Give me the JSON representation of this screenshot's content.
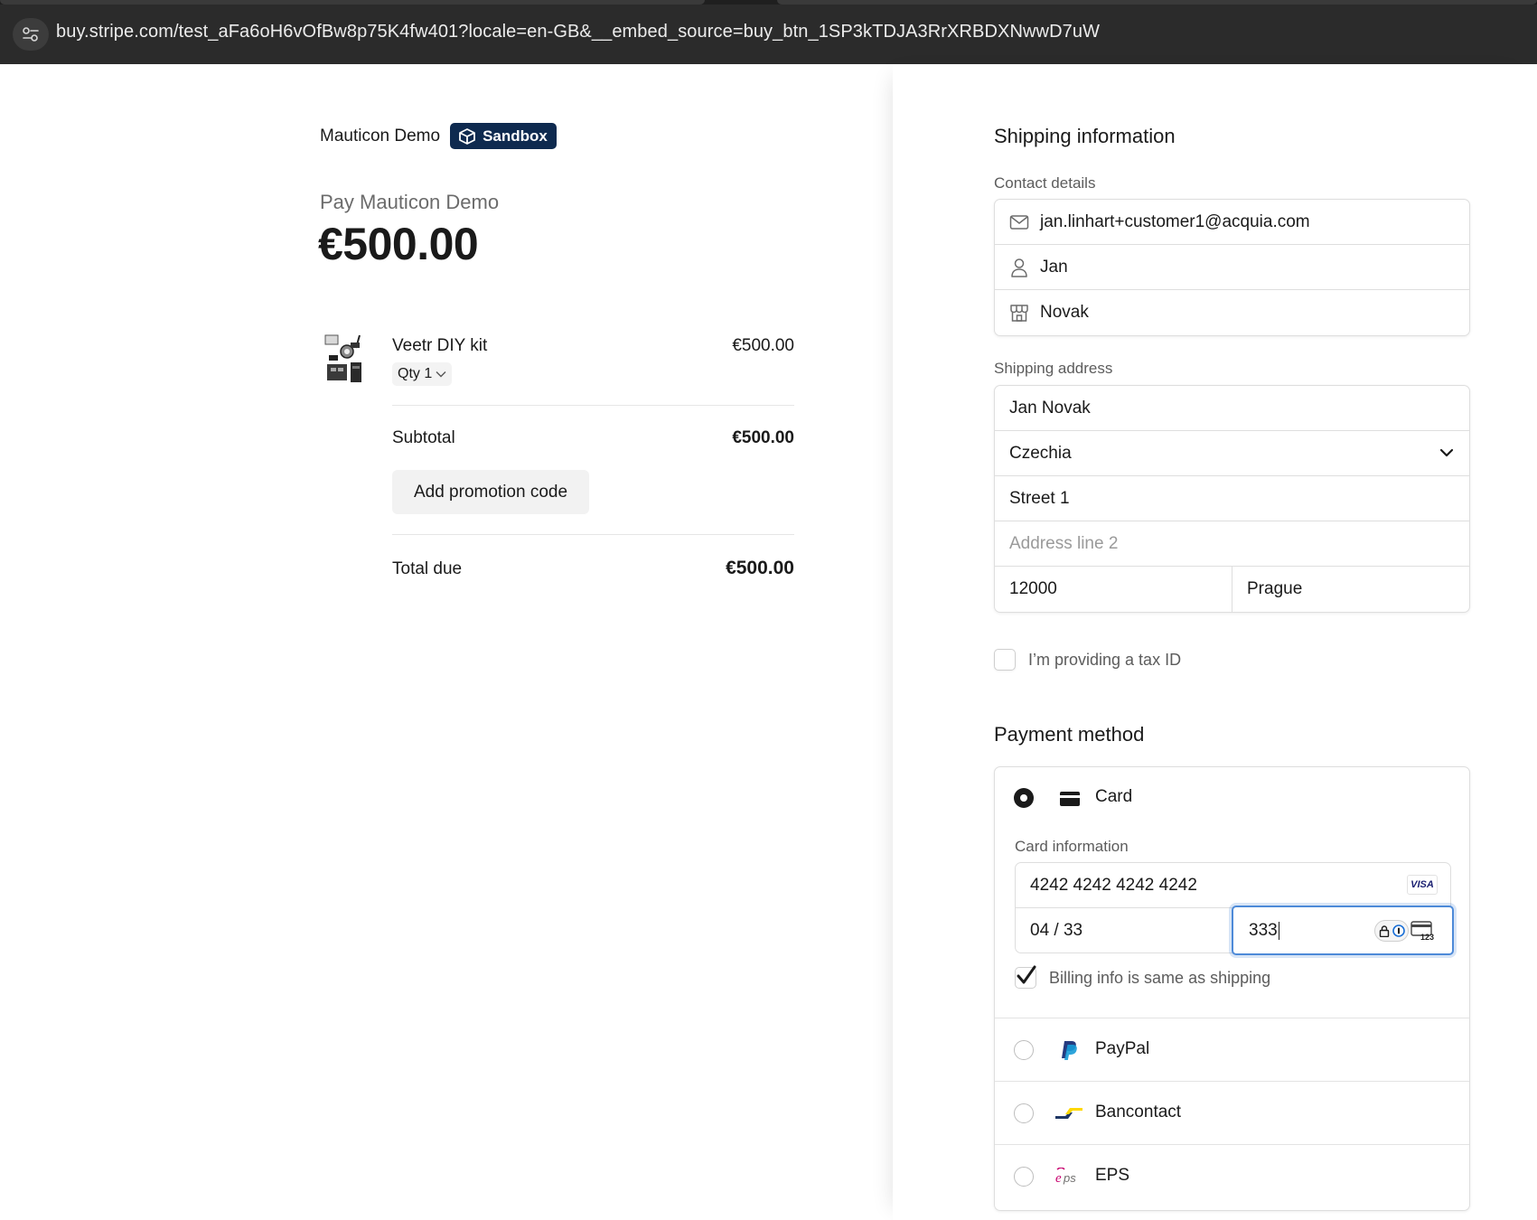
{
  "browser": {
    "url": "buy.stripe.com/test_aFa6oH6vOfBw8p75K4fw401?locale=en-GB&__embed_source=buy_btn_1SP3kTDJA3RrXRBDXNwwD7uW"
  },
  "summary": {
    "merchant_name": "Mauticon Demo",
    "sandbox_label": "Sandbox",
    "pay_label": "Pay Mauticon Demo",
    "pay_amount": "€500.00",
    "item": {
      "name": "Veetr DIY kit",
      "qty_label": "Qty 1",
      "price": "€500.00"
    },
    "subtotal_label": "Subtotal",
    "subtotal_value": "€500.00",
    "promo_label": "Add promotion code",
    "total_label": "Total due",
    "total_value": "€500.00"
  },
  "shipping": {
    "title": "Shipping information",
    "contact_label": "Contact details",
    "email": "jan.linhart+customer1@acquia.com",
    "first_name": "Jan",
    "last_name": "Novak",
    "address_label": "Shipping address",
    "full_name": "Jan Novak",
    "country": "Czechia",
    "line1": "Street 1",
    "line2_placeholder": "Address line 2",
    "postal_code": "12000",
    "city": "Prague",
    "tax_id_label": "I’m providing a tax ID"
  },
  "payment": {
    "title": "Payment method",
    "card_label": "Card",
    "card_info_label": "Card information",
    "card_number": "4242 4242 4242 4242",
    "card_brand": "VISA",
    "expiry": "04 / 33",
    "cvc": "333",
    "cvc_hint": "123",
    "billing_same_label": "Billing info is same as shipping",
    "billing_same_checked": true,
    "methods": [
      {
        "label": "PayPal"
      },
      {
        "label": "Bancontact"
      },
      {
        "label": "EPS"
      }
    ]
  },
  "colors": {
    "sandbox_bg": "#0e2a4f",
    "focus_blue": "#4d8ad8",
    "paypal_dark": "#253b80",
    "paypal_light": "#179bd7",
    "bancontact_blue": "#1e3764",
    "bancontact_yellow": "#ffd800",
    "eps_red": "#c8036f"
  }
}
